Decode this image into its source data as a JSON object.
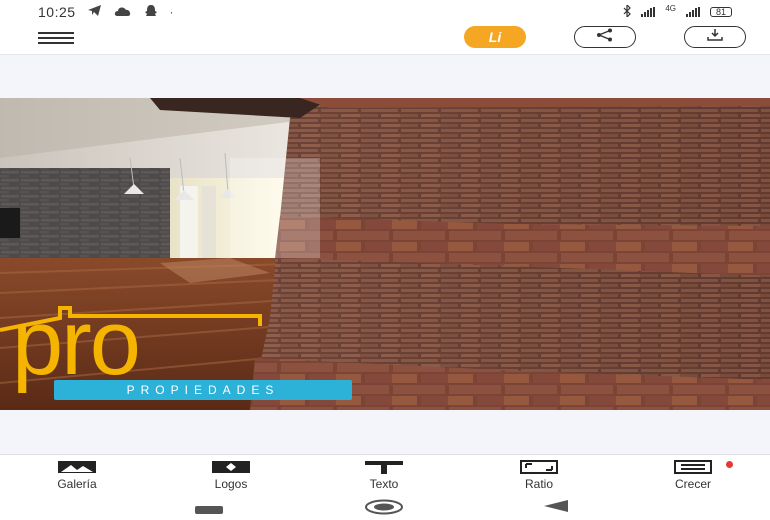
{
  "status_bar": {
    "time": "10:25",
    "network": "4G",
    "battery": "81"
  },
  "app_bar": {
    "pill_orange_label": "Li",
    "menu_icon": "hamburger-icon",
    "share_icon": "share-icon",
    "download_icon": "download-icon"
  },
  "logo": {
    "wordmark": "pro",
    "tagline": "PROPIEDADES",
    "wordmark_color": "#f5b400",
    "tagline_bg": "#2cb1d9"
  },
  "toolbar": {
    "items": [
      {
        "label": "Galería",
        "icon": "gallery-icon"
      },
      {
        "label": "Logos",
        "icon": "logo-icon"
      },
      {
        "label": "Texto",
        "icon": "text-icon"
      },
      {
        "label": "Ratio",
        "icon": "ratio-icon"
      },
      {
        "label": "Crecer",
        "icon": "grow-icon"
      }
    ]
  },
  "colors": {
    "accent": "#f5a623",
    "background": "#f4f5fa"
  }
}
